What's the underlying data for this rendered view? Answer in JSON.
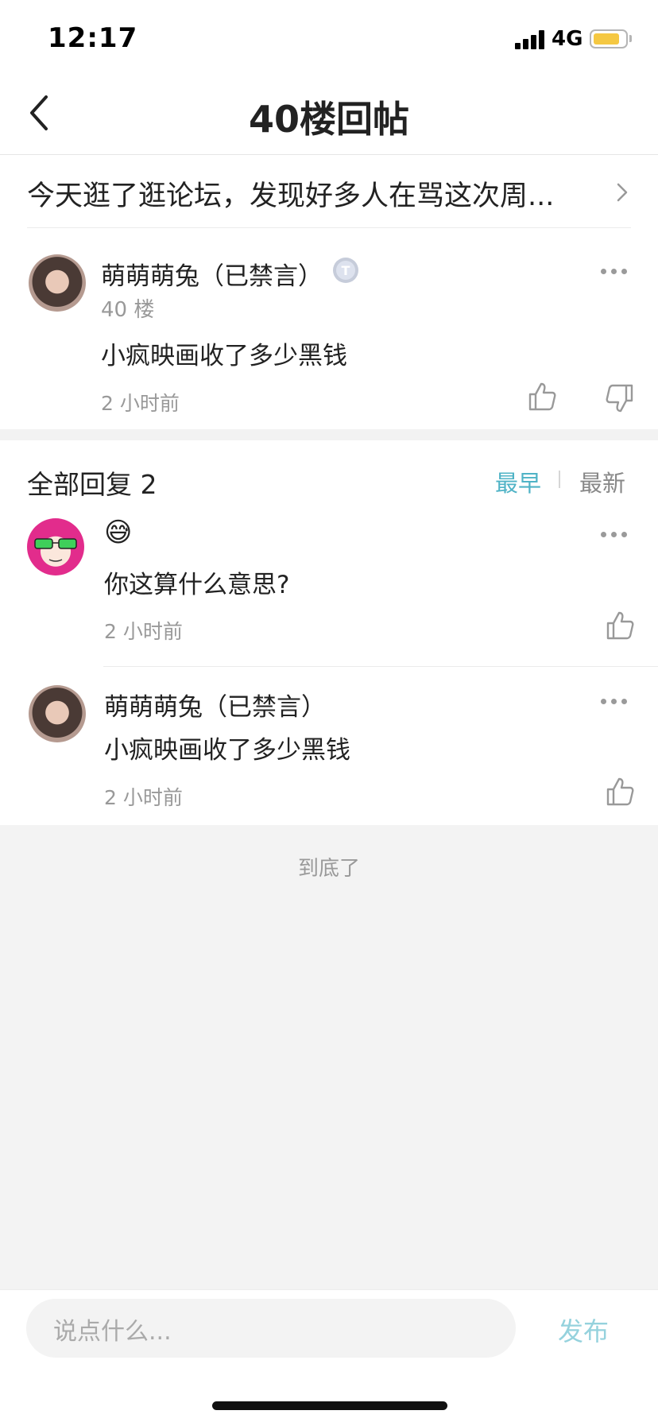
{
  "status_bar": {
    "time": "12:17",
    "network": "4G",
    "battery_color": "#f5c842"
  },
  "nav": {
    "title": "40楼回帖"
  },
  "thread": {
    "title": "今天逛了逛论坛，发现好多人在骂这次周..."
  },
  "floor_post": {
    "user": "萌萌萌兔（已禁言）",
    "badge": "T",
    "floor": "40 楼",
    "content": "小疯映画收了多少黑钱",
    "time": "2 小时前"
  },
  "replies_header": {
    "label": "全部回复",
    "count": "2",
    "sort_early": "最早",
    "sort_new": "最新"
  },
  "replies": [
    {
      "user_emoji": "😅",
      "content": "你这算什么意思?",
      "time": "2 小时前"
    },
    {
      "user": "萌萌萌兔（已禁言）",
      "content": "小疯映画收了多少黑钱",
      "time": "2 小时前"
    }
  ],
  "end_text": "到底了",
  "composer": {
    "placeholder": "说点什么...",
    "publish": "发布"
  },
  "colors": {
    "accent": "#4fb3c6",
    "publish_disabled": "#95d2dd"
  }
}
